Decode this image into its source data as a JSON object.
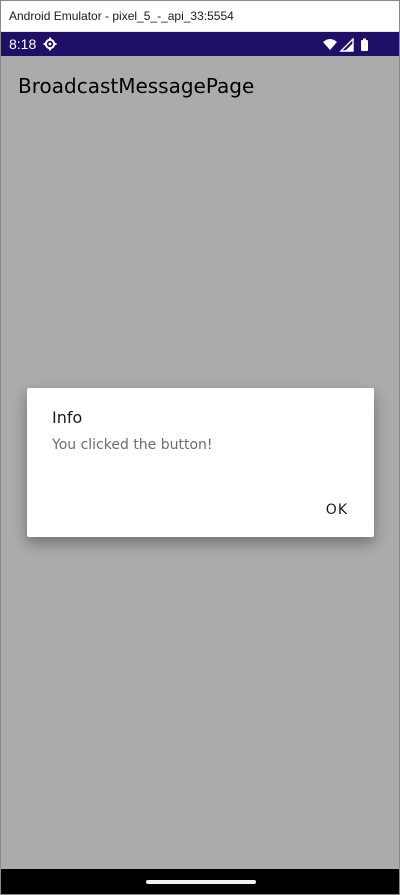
{
  "window": {
    "title": "Android Emulator - pixel_5_-_api_33:5554"
  },
  "status_bar": {
    "time": "8:18",
    "icons": [
      "settings-icon",
      "wifi-icon",
      "signal-icon",
      "battery-icon"
    ],
    "background_color": "#1f0f66"
  },
  "page": {
    "title": "BroadcastMessagePage",
    "background_color": "#ababab"
  },
  "dialog": {
    "title": "Info",
    "message": "You clicked the button!",
    "ok_label": "OK"
  }
}
